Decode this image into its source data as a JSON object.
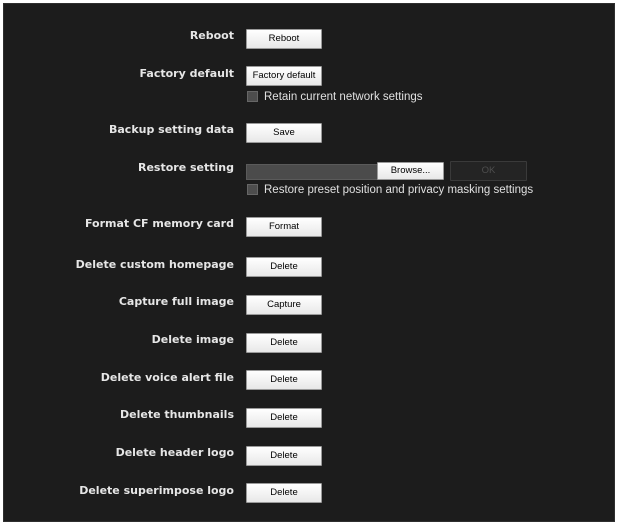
{
  "rows": {
    "reboot": {
      "label": "Reboot",
      "button": "Reboot"
    },
    "factory_default": {
      "label": "Factory default",
      "button": "Factory default",
      "checkbox_label": "Retain current network settings",
      "checked": false
    },
    "backup": {
      "label": "Backup setting data",
      "button": "Save"
    },
    "restore": {
      "label": "Restore setting",
      "file_value": "",
      "browse_button": "Browse...",
      "ok_button": "OK",
      "checkbox_label": "Restore preset position and privacy masking settings",
      "checked": false
    },
    "format_cf": {
      "label": "Format CF memory card",
      "button": "Format"
    },
    "delete_homepage": {
      "label": "Delete custom homepage",
      "button": "Delete"
    },
    "capture": {
      "label": "Capture full image",
      "button": "Capture"
    },
    "delete_image": {
      "label": "Delete image",
      "button": "Delete"
    },
    "delete_voice": {
      "label": "Delete voice alert file",
      "button": "Delete"
    },
    "delete_thumbnails": {
      "label": "Delete thumbnails",
      "button": "Delete"
    },
    "delete_header_logo": {
      "label": "Delete header logo",
      "button": "Delete"
    },
    "delete_superimpose_logo": {
      "label": "Delete superimpose logo",
      "button": "Delete"
    }
  },
  "colors": {
    "panel_background": "#1c1c1c",
    "label_text": "#e6e6e6",
    "button_face": "#f2f2f2",
    "disabled_button_text": "#4e4e4e"
  }
}
